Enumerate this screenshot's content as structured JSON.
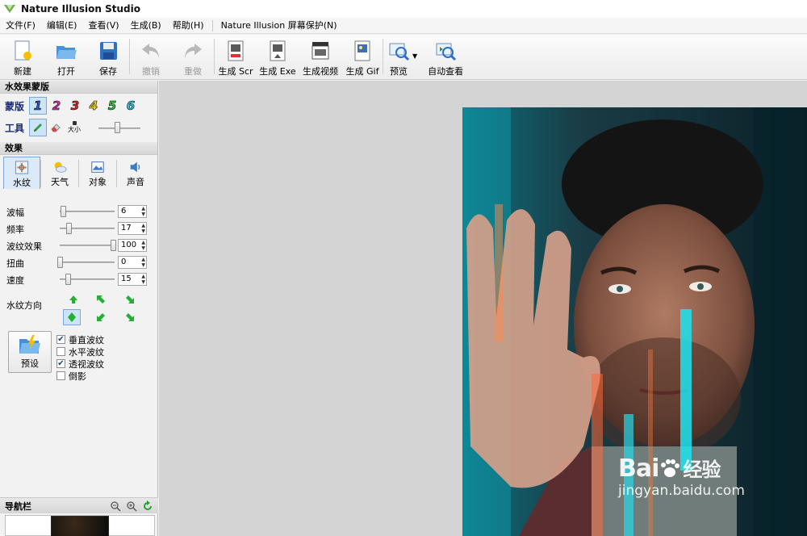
{
  "window": {
    "title": "Nature Illusion Studio"
  },
  "menu": [
    "文件(F)",
    "编辑(E)",
    "查看(V)",
    "生成(B)",
    "帮助(H)",
    "Nature Illusion 屏幕保护(N)"
  ],
  "toolbar": {
    "new": "新建",
    "open": "打开",
    "save": "保存",
    "undo": "撤销",
    "redo": "重做",
    "gen_scr": "生成 Scr",
    "gen_exe": "生成 Exe",
    "gen_video": "生成视频",
    "gen_gif": "生成 Gif",
    "preview": "预览",
    "auto_view": "自动查看"
  },
  "mask_section": {
    "title": "水效果蒙版",
    "mask_label": "蒙版",
    "masks": [
      "1",
      "2",
      "3",
      "4",
      "5",
      "6"
    ],
    "mask_colors": [
      "#2b55d8",
      "#e02fb6",
      "#e02020",
      "#f2d21e",
      "#2ecc3a",
      "#22c8e0"
    ],
    "tool_label": "工具",
    "size_label": "大小",
    "brush_size": 0.45
  },
  "effects_section": {
    "title": "效果",
    "tabs": [
      "水纹",
      "天气",
      "对象",
      "声音"
    ]
  },
  "params": [
    {
      "label": "波幅",
      "value": "6",
      "level": 0.06
    },
    {
      "label": "频率",
      "value": "17",
      "level": 0.17
    },
    {
      "label": "波纹效果",
      "value": "100",
      "level": 1.0
    },
    {
      "label": "扭曲",
      "value": "0",
      "level": 0.0
    },
    {
      "label": "速度",
      "value": "15",
      "level": 0.15
    }
  ],
  "direction": {
    "label": "水纹方向"
  },
  "preset": {
    "label": "预设"
  },
  "checkboxes": [
    {
      "label": "垂直波纹",
      "checked": true
    },
    {
      "label": "水平波纹",
      "checked": false
    },
    {
      "label": "透视波纹",
      "checked": true
    },
    {
      "label": "倒影",
      "checked": false
    }
  ],
  "navigator": {
    "title": "导航栏"
  },
  "watermark": {
    "brand": "Bai",
    "brand_cn": "经验",
    "url": "jingyan.baidu.com"
  }
}
